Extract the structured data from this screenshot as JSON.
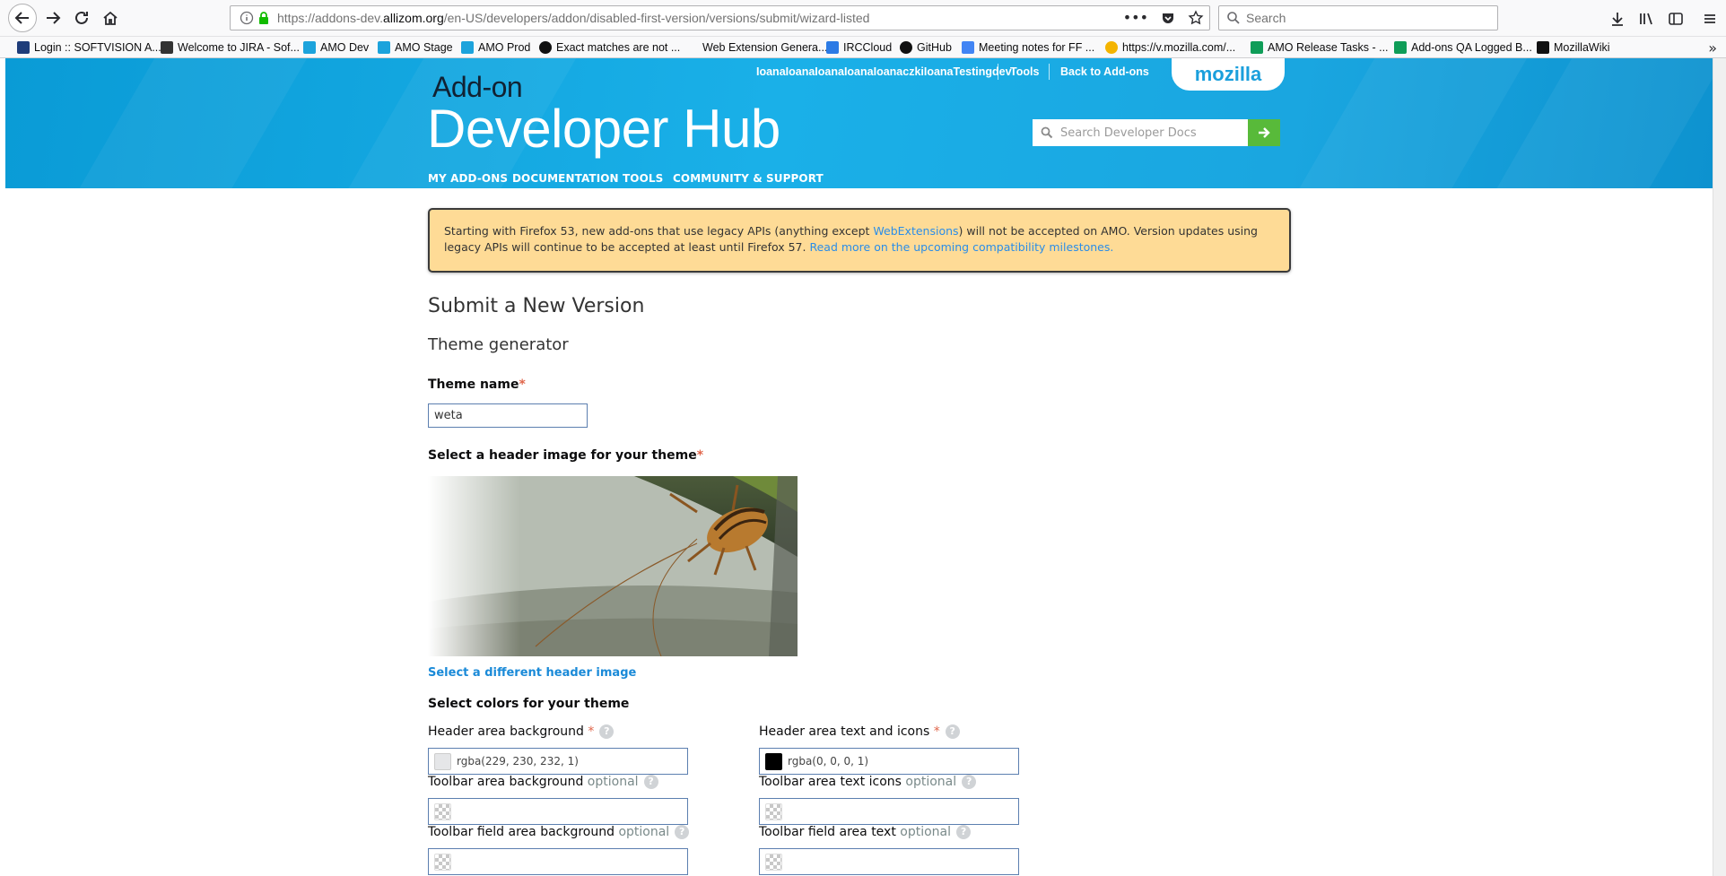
{
  "browser": {
    "url_prefix": "https://addons-dev.",
    "url_host": "allizom.org",
    "url_path": "/en-US/developers/addon/disabled-first-version/versions/submit/wizard-listed",
    "page_actions": "•••",
    "search_placeholder": "Search",
    "bookmarks": [
      {
        "label": "Login :: SOFTVISION A...",
        "color": "#1f3d7a"
      },
      {
        "label": "Welcome to JIRA - Sof...",
        "color": "#333333"
      },
      {
        "label": "AMO Dev",
        "color": "#1ca3dc"
      },
      {
        "label": "AMO Stage",
        "color": "#1ca3dc"
      },
      {
        "label": "AMO Prod",
        "color": "#1ca3dc"
      },
      {
        "label": "Exact matches are not ...",
        "color": "#111111"
      },
      {
        "label": "Web Extension Genera...",
        "color": "#ffffff"
      },
      {
        "label": "IRCCloud",
        "color": "#2c7be5"
      },
      {
        "label": "GitHub",
        "color": "#111111"
      },
      {
        "label": "Meeting notes for FF ...",
        "color": "#4285f4"
      },
      {
        "label": "https://v.mozilla.com/...",
        "color": "#f4b400"
      },
      {
        "label": "AMO Release Tasks - ...",
        "color": "#0f9d58"
      },
      {
        "label": "Add-ons QA Logged B...",
        "color": "#0f9d58"
      },
      {
        "label": "MozillaWiki",
        "color": "#111111"
      }
    ],
    "bookmarks_overflow": "»"
  },
  "header": {
    "addon_label": "Add-on",
    "hub_title": "Developer Hub",
    "username": "IoanaIoanaIoanaIoanaIoanaczkiIoanaTestingdev",
    "tools": "Tools",
    "back_to_addons": "Back to Add-ons",
    "mozilla": "mozilla",
    "search_placeholder": "Search Developer Docs",
    "nav": [
      "MY ADD-ONS",
      "DOCUMENTATION",
      "TOOLS",
      "COMMUNITY & SUPPORT"
    ]
  },
  "notice": {
    "text1": "Starting with Firefox 53, new add-ons that use legacy APIs (anything except ",
    "link1": "WebExtensions",
    "text2": ") will not be accepted on AMO. Version updates using legacy APIs will continue to be accepted at least until Firefox 57. ",
    "link2": "Read more on the upcoming compatibility milestones."
  },
  "form": {
    "title": "Submit a New Version",
    "subtitle": "Theme generator",
    "theme_name_label": "Theme name",
    "required_mark": "*",
    "theme_name_value": "weta",
    "header_image_label": "Select a header image for your theme",
    "select_different": "Select a different header image",
    "colors_label": "Select colors for your theme",
    "optional": "optional",
    "help": "?",
    "fields": [
      {
        "label": "Header area background",
        "required": true,
        "value": "rgba(229, 230, 232, 1)",
        "swatch": "#e5e6e8"
      },
      {
        "label": "Header area text and icons",
        "required": true,
        "value": "rgba(0, 0, 0, 1)",
        "swatch": "#000000"
      },
      {
        "label": "Toolbar area background",
        "required": false,
        "value": "",
        "swatch": ""
      },
      {
        "label": "Toolbar area text icons",
        "required": false,
        "value": "",
        "swatch": ""
      },
      {
        "label": "Toolbar field area background",
        "required": false,
        "value": "",
        "swatch": ""
      },
      {
        "label": "Toolbar field area text",
        "required": false,
        "value": "",
        "swatch": ""
      }
    ]
  }
}
